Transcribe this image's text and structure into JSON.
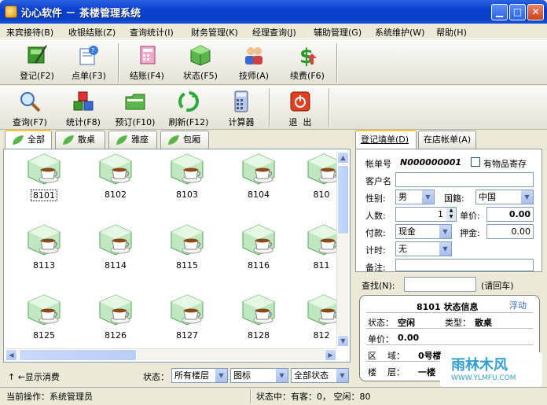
{
  "window": {
    "title": "沁心软件 － 茶楼管理系统"
  },
  "menu": [
    "来宾接待(B)",
    "收银结账(Z)",
    "查询统计(I)",
    "财务管理(K)",
    "经理查询(J)",
    "辅助管理(G)",
    "系统维护(W)",
    "帮助(H)"
  ],
  "toolbar1": [
    {
      "label": "登记(F2)",
      "icon": "register-icon"
    },
    {
      "label": "点单(F3)",
      "icon": "order-icon"
    },
    {
      "label": "结账(F4)",
      "icon": "checkout-icon"
    },
    {
      "label": "状态(F5)",
      "icon": "status-icon"
    },
    {
      "label": "技师(A)",
      "icon": "technician-icon"
    },
    {
      "label": "续费(F6)",
      "icon": "renew-fee-icon"
    }
  ],
  "toolbar2": [
    {
      "label": "查询(F7)",
      "icon": "query-icon"
    },
    {
      "label": "统计(F8)",
      "icon": "statistics-icon"
    },
    {
      "label": "预订(F10)",
      "icon": "reserve-icon"
    },
    {
      "label": "刷新(F12)",
      "icon": "refresh-icon"
    },
    {
      "label": "计算器",
      "icon": "calculator-icon"
    },
    {
      "label": "退  出",
      "icon": "exit-icon"
    }
  ],
  "room_tabs": [
    "全部",
    "散桌",
    "雅座",
    "包厢"
  ],
  "rooms": [
    "8101",
    "8102",
    "8103",
    "8104",
    "810",
    "8113",
    "8114",
    "8115",
    "8116",
    "811",
    "8125",
    "8126",
    "8127",
    "8128",
    "812"
  ],
  "filter": {
    "toggle": "↑ ←显示消费",
    "status_label": "状态：",
    "floor": "所有楼层",
    "view": "图标",
    "state": "全部状态"
  },
  "status": {
    "operation": "当前操作：系统管理员",
    "summary": "状态中：有客：0， 空闲：80"
  },
  "right_tabs": [
    "登记填单(D)",
    "在店帐单(A)"
  ],
  "form": {
    "account_label": "帐单号",
    "account_value": "N000000001",
    "deposit_label": "有物品寄存",
    "customer_label": "客户名",
    "customer_value": "",
    "gender_label": "性别:",
    "gender_value": "男",
    "nationality_label": "国籍:",
    "nationality_value": "中国",
    "people_label": "人数:",
    "people_value": "1",
    "price_label": "单价:",
    "price_value": "0.00",
    "payment_label": "付款:",
    "payment_value": "现金",
    "deposit_money_label": "押金:",
    "deposit_money_value": "0.00",
    "timing_label": "计时:",
    "timing_value": "无",
    "remark_label": "备注:"
  },
  "search": {
    "label": "查找(N):",
    "hint": "(请回车)",
    "value": ""
  },
  "info": {
    "title": "8101 状态信息",
    "float": "浮动",
    "state_label": "状态：",
    "state_value": "空闲",
    "type_label": "类型：",
    "type_value": "散桌",
    "price_label": "单价：",
    "price_value": "0.00",
    "area_label": "区    域：",
    "area_value": "0号楼",
    "floor_label": "楼    层：",
    "floor_value": "一楼"
  },
  "watermark": {
    "name": "雨林木风",
    "url": "WWW.YLMFU.COM"
  }
}
